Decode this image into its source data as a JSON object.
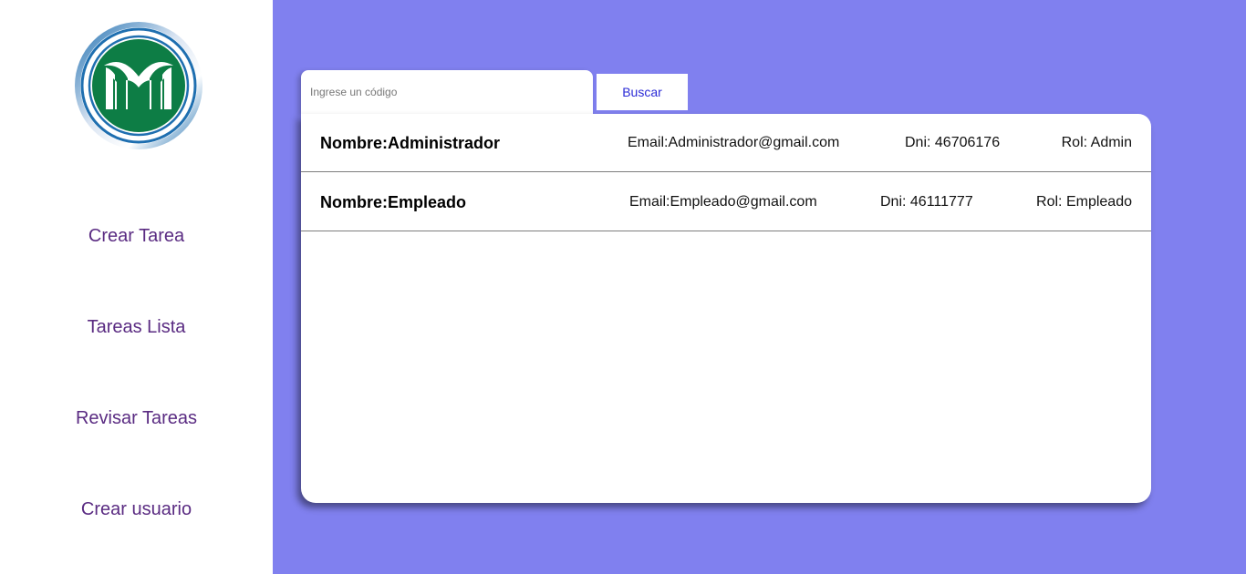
{
  "sidebar": {
    "logo_icon": "company-logo",
    "logo_colors": {
      "ring": "#1f6fb0",
      "disc": "#0d7d45"
    },
    "items": [
      {
        "label": "Crear Tarea"
      },
      {
        "label": "Tareas Lista"
      },
      {
        "label": "Revisar Tareas"
      },
      {
        "label": "Crear usuario"
      }
    ]
  },
  "search": {
    "placeholder": "Ingrese un código",
    "value": "",
    "button_label": "Buscar"
  },
  "users": [
    {
      "name": "Nombre:Administrador",
      "email": "Email:Administrador@gmail.com",
      "dni": "Dni: 46706176",
      "rol": "Rol: Admin"
    },
    {
      "name": "Nombre:Empleado",
      "email": "Email:Empleado@gmail.com",
      "dni": "Dni: 46111777",
      "rol": "Rol: Empleado"
    }
  ],
  "colors": {
    "main_background": "#8080ef",
    "nav_text": "#5a2b82",
    "button_text": "#2a2ad6"
  }
}
